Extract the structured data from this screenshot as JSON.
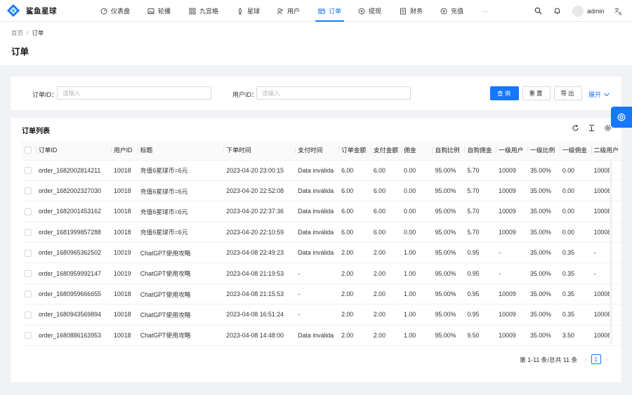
{
  "app": {
    "brand": "鲨鱼星球"
  },
  "nav": {
    "items": [
      {
        "label": "仪表盘",
        "icon": "dashboard-icon"
      },
      {
        "label": "轮播",
        "icon": "image-icon"
      },
      {
        "label": "九宫格",
        "icon": "grid-icon"
      },
      {
        "label": "星球",
        "icon": "planet-icon"
      },
      {
        "label": "用户",
        "icon": "users-icon"
      },
      {
        "label": "订单",
        "icon": "order-icon",
        "active": true
      },
      {
        "label": "提现",
        "icon": "withdraw-icon"
      },
      {
        "label": "财务",
        "icon": "finance-icon"
      },
      {
        "label": "充值",
        "icon": "recharge-icon"
      }
    ],
    "more": "···",
    "user": "admin"
  },
  "breadcrumb": {
    "home": "首页",
    "separator": "/",
    "current": "订单"
  },
  "page": {
    "title": "订单"
  },
  "search": {
    "order_id_label": "订单ID：",
    "order_id_placeholder": "请输入",
    "user_id_label": "用户ID：",
    "user_id_placeholder": "请输入",
    "query_button": "查询",
    "reset_button": "重置",
    "export_button": "导出",
    "expand_link": "展开"
  },
  "table": {
    "title": "订单列表",
    "columns": [
      "订单ID",
      "用户ID",
      "标题",
      "下单时间",
      "支付时间",
      "订单金额",
      "支付金额",
      "佣金",
      "自购比例",
      "自购佣金",
      "一级用户",
      "一级比例",
      "一级佣金",
      "二级用户"
    ],
    "rows": [
      [
        "order_1682002814211",
        "10018",
        "充值6星球币=6元",
        "2023-04-20 23:00:15",
        "Data inválida",
        "6.00",
        "6.00",
        "0.00",
        "95.00%",
        "5.70",
        "10009",
        "35.00%",
        "0.00",
        "10008"
      ],
      [
        "order_1682002327030",
        "10018",
        "充值6星球币=6元",
        "2023-04-20 22:52:08",
        "Data inválida",
        "6.00",
        "6.00",
        "0.00",
        "95.00%",
        "5.70",
        "10009",
        "35.00%",
        "0.00",
        "10008"
      ],
      [
        "order_1682001453162",
        "10018",
        "充值6星球币=6元",
        "2023-04-20 22:37:36",
        "Data inválida",
        "6.00",
        "6.00",
        "0.00",
        "95.00%",
        "5.70",
        "10009",
        "35.00%",
        "0.00",
        "10008"
      ],
      [
        "order_1681999857288",
        "10018",
        "充值6星球币=6元",
        "2023-04-20 22:10:59",
        "Data inválida",
        "6.00",
        "6.00",
        "0.00",
        "95.00%",
        "5.70",
        "10009",
        "35.00%",
        "0.00",
        "10008"
      ],
      [
        "order_1680965362502",
        "10019",
        "ChatGPT使用攻略",
        "2023-04-08 22:49:23",
        "Data inválida",
        "2.00",
        "2.00",
        "1.00",
        "95.00%",
        "0.95",
        "-",
        "35.00%",
        "0.35",
        "-"
      ],
      [
        "order_1680959992147",
        "10019",
        "ChatGPT使用攻略",
        "2023-04-08 21:19:53",
        "-",
        "2.00",
        "2.00",
        "1.00",
        "95.00%",
        "0.95",
        "-",
        "35.00%",
        "0.35",
        "-"
      ],
      [
        "order_1680959666655",
        "10018",
        "ChatGPT使用攻略",
        "2023-04-08 21:15:53",
        "-",
        "2.00",
        "2.00",
        "1.00",
        "95.00%",
        "0.95",
        "10009",
        "35.00%",
        "0.35",
        "10008"
      ],
      [
        "order_1680943569894",
        "10018",
        "ChatGPT使用攻略",
        "2023-04-08 16:51:24",
        "-",
        "2.00",
        "2.00",
        "1.00",
        "95.00%",
        "0.95",
        "10009",
        "35.00%",
        "0.35",
        "10008"
      ],
      [
        "order_1680886163953",
        "10018",
        "ChatGPT使用攻略",
        "2023-04-08 14:48:00",
        "Data inválida",
        "2.00",
        "2.00",
        "1.00",
        "95.00%",
        "9.50",
        "10009",
        "35.00%",
        "3.50",
        "10008"
      ]
    ]
  },
  "pagination": {
    "summary": "第 1-11 条/总共 11 条",
    "current_page": "1"
  },
  "colors": {
    "primary": "#1677ff"
  }
}
